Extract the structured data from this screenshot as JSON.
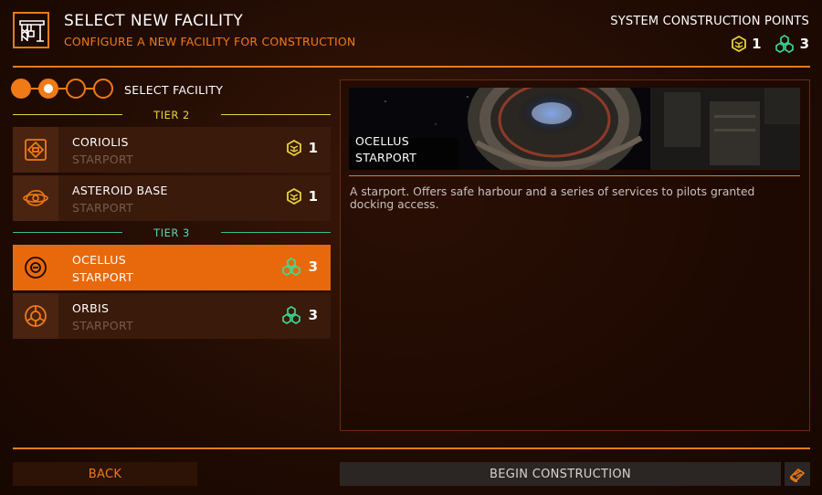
{
  "header": {
    "title": "SELECT NEW FACILITY",
    "subtitle": "CONFIGURE A NEW FACILITY FOR CONSTRUCTION",
    "logo_icon": "construction-crane-icon"
  },
  "construction_points": {
    "title": "SYSTEM CONSTRUCTION POINTS",
    "tier2_points": "1",
    "tier3_points": "3",
    "tier2_color": "#e8d23a",
    "tier3_color": "#3ddc9a"
  },
  "stepper": {
    "label": "SELECT FACILITY",
    "total_steps": 4,
    "current_step": 2
  },
  "tiers": [
    {
      "label": "TIER 2",
      "facilities": [
        {
          "name": "CORIOLIS",
          "type": "STARPORT",
          "cost": "1",
          "icon": "coriolis-icon",
          "selected": false
        },
        {
          "name": "ASTEROID BASE",
          "type": "STARPORT",
          "cost": "1",
          "icon": "asteroid-base-icon",
          "selected": false
        }
      ]
    },
    {
      "label": "TIER 3",
      "facilities": [
        {
          "name": "OCELLUS",
          "type": "STARPORT",
          "cost": "3",
          "icon": "ocellus-icon",
          "selected": true
        },
        {
          "name": "ORBIS",
          "type": "STARPORT",
          "cost": "3",
          "icon": "orbis-icon",
          "selected": false
        }
      ]
    }
  ],
  "preview": {
    "name": "OCELLUS",
    "type": "STARPORT",
    "description": "A starport. Offers safe harbour and a series of services to pilots granted docking access."
  },
  "footer": {
    "back_label": "BACK",
    "begin_label": "BEGIN CONSTRUCTION",
    "codex_icon": "codex-book-icon"
  },
  "colors": {
    "accent": "#f07a16",
    "selected_row": "#e8690c"
  }
}
